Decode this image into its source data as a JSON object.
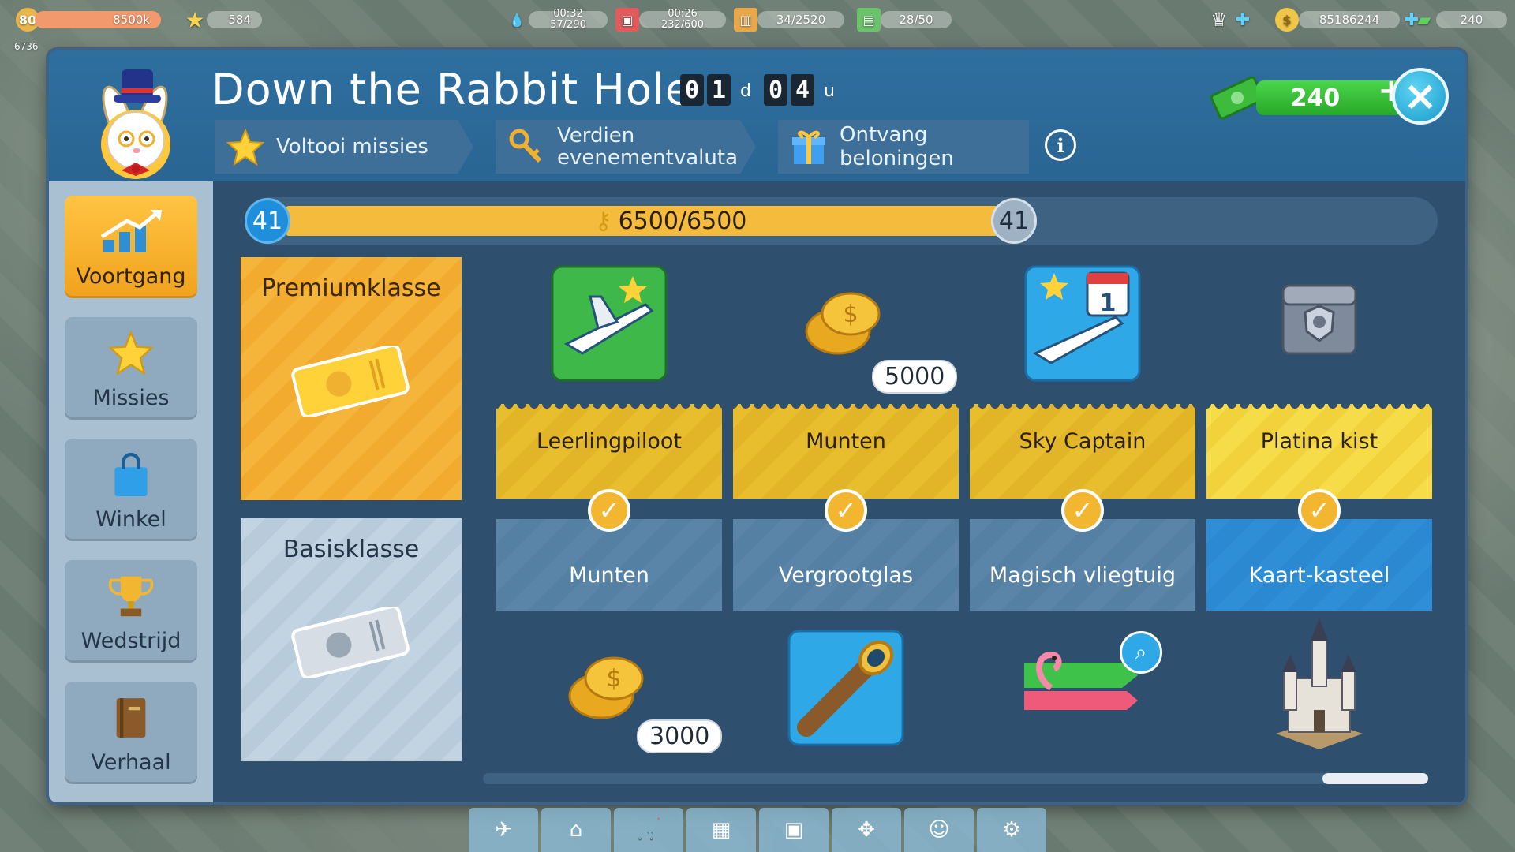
{
  "hud": {
    "level": "80",
    "xp": "8500k",
    "stars": "584",
    "fuel": "57/290",
    "fuel_timer": "00:32",
    "cargo": "232/600",
    "cargo_timer": "00:26",
    "passengers": "34/2520",
    "crew": "28/50",
    "coins": "85186244",
    "cash": "240",
    "population": "6736"
  },
  "event": {
    "title": "Down the Rabbit Hole",
    "timer_days": [
      "0",
      "1"
    ],
    "days_unit": "d",
    "timer_hours": [
      "0",
      "4"
    ],
    "hours_unit": "u",
    "steps": [
      {
        "label": "Voltooi missies",
        "icon": "star-icon"
      },
      {
        "label": "Verdien evenementvaluta",
        "icon": "key-icon"
      },
      {
        "label": "Ontvang beloningen",
        "icon": "gift-icon"
      }
    ],
    "info": "i",
    "cash_amount": "240",
    "cash_plus": "+",
    "close": "×"
  },
  "sidebar": {
    "items": [
      {
        "label": "Voortgang",
        "icon": "progress-chart-icon",
        "active": true
      },
      {
        "label": "Missies",
        "icon": "star-icon",
        "active": false
      },
      {
        "label": "Winkel",
        "icon": "shopping-bag-icon",
        "active": false
      },
      {
        "label": "Wedstrijd",
        "icon": "trophy-icon",
        "active": false
      },
      {
        "label": "Verhaal",
        "icon": "book-icon",
        "active": false
      }
    ]
  },
  "progress": {
    "level_current": "41",
    "level_next": "41",
    "text": "6500/6500",
    "fraction": 1.0
  },
  "tiers": {
    "premium": "Premiumklasse",
    "basic": "Basisklasse"
  },
  "rewards": [
    {
      "premium": "Leerlingpiloot",
      "premium_icon": "plane-icon",
      "basic": "Munten",
      "basic_icon": "coins-icon",
      "basic_amount": "3000"
    },
    {
      "premium": "Munten",
      "premium_icon": "coins-icon",
      "premium_amount": "5000",
      "basic": "Vergrootglas",
      "basic_icon": "spyglass-icon"
    },
    {
      "premium": "Sky Captain",
      "premium_icon": "plane-calendar-icon",
      "basic": "Magisch vliegtuig",
      "basic_icon": "flamingo-plane-icon"
    },
    {
      "premium": "Platina kist",
      "premium_icon": "platinum-chest-icon",
      "basic": "Kaart-kasteel",
      "basic_icon": "castle-icon"
    }
  ],
  "colors": {
    "panel": "#2f4f6e",
    "header": "#2e6f9f",
    "premium": "#f5b43a",
    "basic": "#c2d4e2",
    "progress": "#f4bb3c",
    "cash": "#28a828"
  }
}
